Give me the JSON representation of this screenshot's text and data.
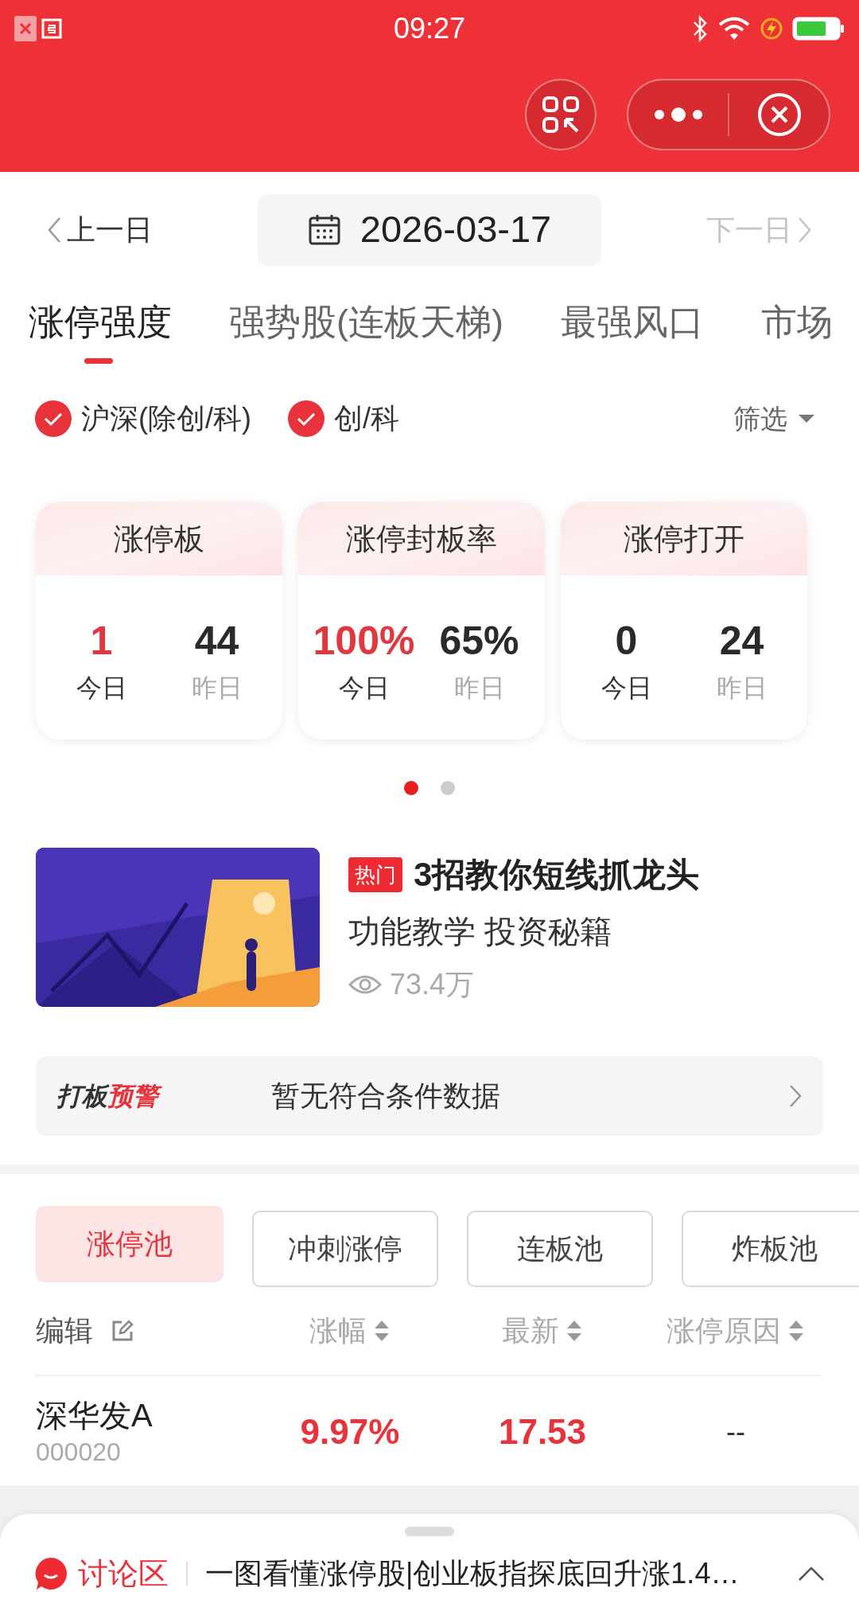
{
  "status_bar": {
    "time": "09:27"
  },
  "date_nav": {
    "prev": "上一日",
    "date": "2026-03-17",
    "next": "下一日",
    "next_disabled": true
  },
  "tabs": [
    {
      "label": "涨停强度",
      "selected": true
    },
    {
      "label": "强势股(连板天梯)",
      "selected": false
    },
    {
      "label": "最强风口",
      "selected": false
    },
    {
      "label": "市场",
      "selected": false
    }
  ],
  "filters": [
    {
      "label": "沪深(除创/科)",
      "checked": true
    },
    {
      "label": "创/科",
      "checked": true
    }
  ],
  "filter_button": "筛选",
  "stat_cards": [
    {
      "title": "涨停板",
      "today": "1",
      "today_label": "今日",
      "yesterday": "44",
      "yesterday_label": "昨日"
    },
    {
      "title": "涨停封板率",
      "today": "100%",
      "today_label": "今日",
      "yesterday": "65%",
      "yesterday_label": "昨日"
    },
    {
      "title": "涨停打开",
      "today": "0",
      "today_label": "今日",
      "yesterday": "24",
      "yesterday_label": "昨日"
    }
  ],
  "pager_dots": [
    {
      "selected": true
    },
    {
      "selected": false
    }
  ],
  "article": {
    "kind": "picture",
    "tag": "热门",
    "title": "3招教你短线抓龙头",
    "subtitle": "功能教学 投资秘籍",
    "views": "73.4万"
  },
  "alert_bar": {
    "logo": [
      {
        "text": "打板",
        "color": "#333333"
      },
      {
        "text": "预警",
        "color": "#e8323c"
      }
    ],
    "message": "暂无符合条件数据"
  },
  "pool_tabs": [
    {
      "label": "涨停池",
      "selected": true
    },
    {
      "label": "冲刺涨停",
      "selected": false
    },
    {
      "label": "连板池",
      "selected": false
    },
    {
      "label": "炸板池",
      "selected": false
    }
  ],
  "table": {
    "edit": "编辑",
    "columns": [
      "涨幅",
      "最新",
      "涨停原因"
    ],
    "rows": [
      {
        "name": "深华发A",
        "code": "000020",
        "change": "9.97%",
        "price": "17.53",
        "reason": "--"
      }
    ]
  },
  "discussion": {
    "label": "讨论区",
    "text": "一图看懂涨停股|创业板指探底回升涨1.4…"
  }
}
